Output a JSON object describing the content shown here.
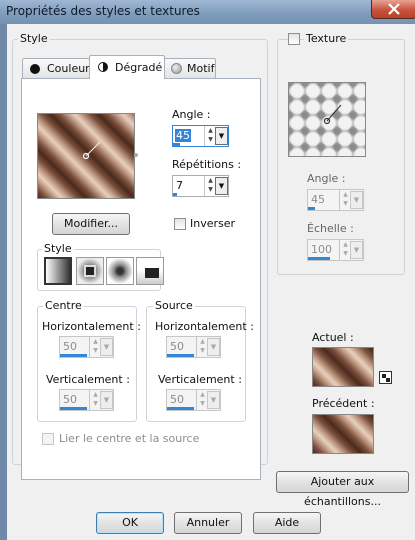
{
  "window": {
    "title": "Propriétés des styles et textures"
  },
  "style_group": {
    "label": "Style"
  },
  "tabs": [
    {
      "label": "Couleur",
      "icon": "filled-circle-icon",
      "active": false
    },
    {
      "label": "Dégradé",
      "icon": "half-circle-icon",
      "active": true
    },
    {
      "label": "Motif",
      "icon": "pattern-sphere-icon",
      "active": false
    }
  ],
  "gradient": {
    "angle_label": "Angle :",
    "angle_value": "45",
    "angle_fill": 0.125,
    "repeat_label": "Répétitions :",
    "repeat_value": "7",
    "repeat_fill": 0.07,
    "modify_label": "Modifier...",
    "invert_label": "Inverser",
    "invert_checked": false,
    "style_label": "Style",
    "style_options": [
      "linear",
      "rectangular",
      "sunburst",
      "radial"
    ],
    "style_selected": "linear",
    "colors": [
      "#4a2a1c",
      "#7a4f3c",
      "#c9a58e",
      "#e6d0bf"
    ]
  },
  "centre": {
    "label": "Centre",
    "h_label": "Horizontalement :",
    "h_value": "50",
    "h_fill": 0.5,
    "v_label": "Verticalement :",
    "v_value": "50",
    "v_fill": 0.5
  },
  "source": {
    "label": "Source",
    "h_label": "Horizontalement :",
    "h_value": "50",
    "h_fill": 0.5,
    "v_label": "Verticalement :",
    "v_value": "50",
    "v_fill": 0.5
  },
  "link": {
    "label": "Lier le centre et la source",
    "checked": false,
    "enabled": false
  },
  "texture": {
    "label": "Texture",
    "checked": false,
    "angle_label": "Angle :",
    "angle_value": "45",
    "angle_fill": 0.125,
    "scale_label": "Échelle :",
    "scale_value": "100",
    "scale_fill": 0.4
  },
  "actuel": {
    "label": "Actuel :"
  },
  "precedent": {
    "label": "Précédent :"
  },
  "add_button": {
    "label": "Ajouter aux échantillons..."
  },
  "buttons": {
    "ok": "OK",
    "cancel": "Annuler",
    "help": "Aide"
  },
  "colors": {
    "accent": "#3385d6",
    "titlebar": "#8ca8c8",
    "close": "#c8543d"
  }
}
